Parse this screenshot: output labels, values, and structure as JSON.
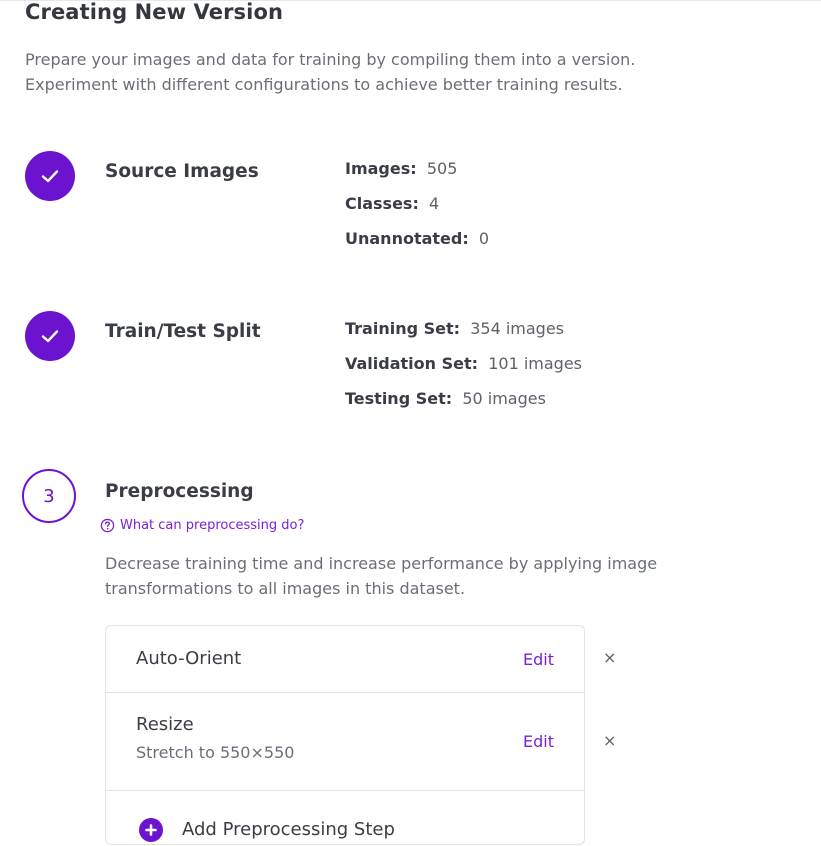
{
  "header": {
    "title": "Creating New Version",
    "intro_line1": "Prepare your images and data for training by compiling them into a version.",
    "intro_line2": "Experiment with different configurations to achieve better training results."
  },
  "steps": {
    "source": {
      "title": "Source Images",
      "stats": [
        {
          "label": "Images:",
          "value": "505"
        },
        {
          "label": "Classes:",
          "value": "4"
        },
        {
          "label": "Unannotated:",
          "value": "0"
        }
      ]
    },
    "split": {
      "title": "Train/Test Split",
      "stats": [
        {
          "label": "Training Set:",
          "value": "354 images"
        },
        {
          "label": "Validation Set:",
          "value": "101 images"
        },
        {
          "label": "Testing Set:",
          "value": "50 images"
        }
      ]
    },
    "preprocessing": {
      "number": "3",
      "title": "Preprocessing",
      "help_link": "What can preprocessing do?",
      "desc_line1": "Decrease training time and increase performance by applying image",
      "desc_line2": "transformations to all images in this dataset.",
      "items": [
        {
          "title": "Auto-Orient",
          "edit": "Edit",
          "remove": "×"
        },
        {
          "title": "Resize",
          "subtitle": "Stretch to 550×550",
          "edit": "Edit",
          "remove": "×"
        }
      ],
      "add_label": "Add Preprocessing Step"
    }
  },
  "colors": {
    "accent": "#6c13cf",
    "link": "#7a21d1"
  }
}
